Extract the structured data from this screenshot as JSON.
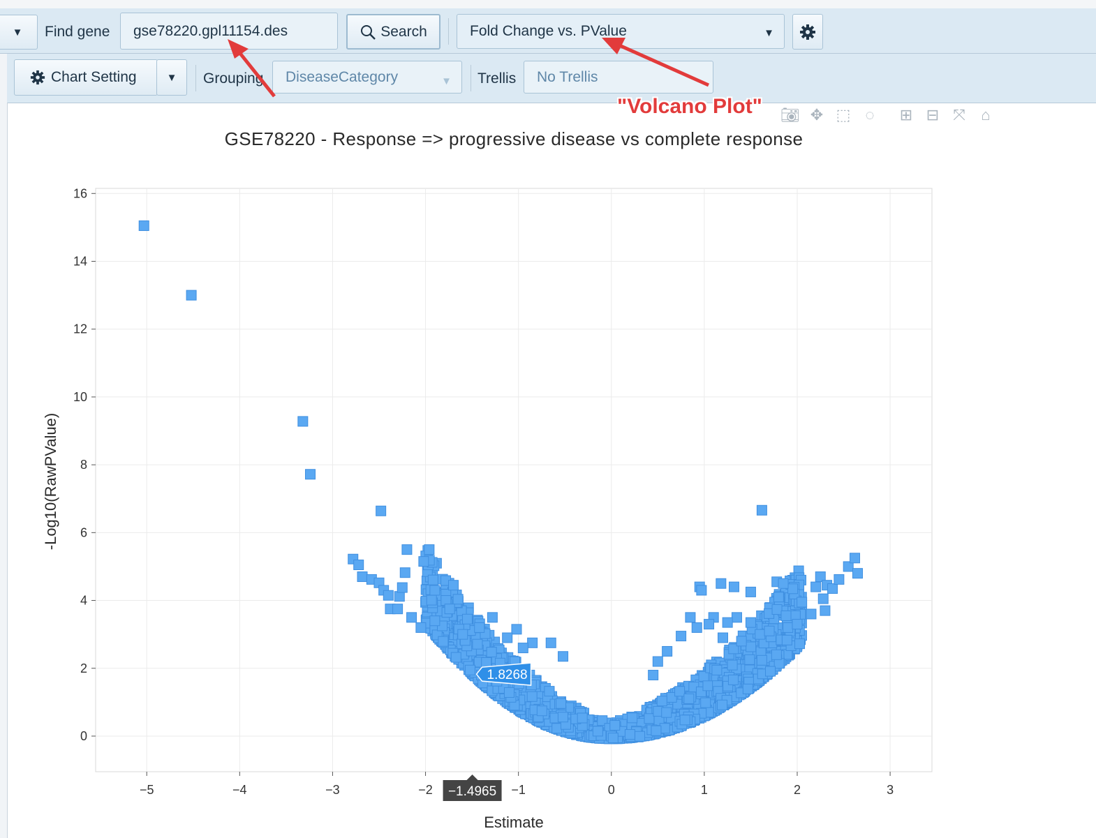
{
  "toolbar": {
    "find_gene_label": "Find gene",
    "gene_input_value": "gse78220.gpl11154.des",
    "search_label": "Search",
    "plot_type_value": "Fold Change vs. PValue"
  },
  "chart_toolbar": {
    "chart_setting_label": "Chart Setting",
    "grouping_label": "Grouping",
    "grouping_value": "DiseaseCategory",
    "trellis_label": "Trellis",
    "trellis_value": "No Trellis"
  },
  "annotation_text": "\"Volcano Plot\"",
  "colors": {
    "marker": "#5aa8f2",
    "marker_stroke": "#3f8fe0",
    "arrow": "#e23b3b",
    "toolbar_bg": "#dbe9f3"
  },
  "chart_data": {
    "type": "scatter",
    "title": "GSE78220 - Response => progressive disease vs complete response",
    "xlabel": "Estimate",
    "ylabel": "-Log10(RawPValue)",
    "xlim": [
      -5.55,
      3.45
    ],
    "ylim": [
      -1.05,
      16.15
    ],
    "xticks": [
      -5,
      -4,
      -3,
      -2,
      -1,
      0,
      1,
      2,
      3
    ],
    "yticks": [
      0,
      2,
      4,
      6,
      8,
      10,
      12,
      14,
      16
    ],
    "grid": true,
    "hover_y_label": "1.8268",
    "hover_x_label": "−1.4965",
    "points": [
      [
        -5.03,
        15.05
      ],
      [
        -4.52,
        13.0
      ],
      [
        -3.32,
        9.28
      ],
      [
        -3.24,
        7.72
      ],
      [
        -2.48,
        6.64
      ],
      [
        1.62,
        6.66
      ],
      [
        -2.78,
        5.22
      ],
      [
        -2.72,
        5.05
      ],
      [
        -2.68,
        4.7
      ],
      [
        -2.58,
        4.62
      ],
      [
        -2.5,
        4.52
      ],
      [
        -2.45,
        4.3
      ],
      [
        -2.4,
        4.15
      ],
      [
        -2.38,
        3.75
      ],
      [
        -2.3,
        3.75
      ],
      [
        -2.28,
        4.12
      ],
      [
        -2.25,
        4.38
      ],
      [
        -2.22,
        4.82
      ],
      [
        -2.2,
        5.5
      ],
      [
        -2.02,
        5.15
      ],
      [
        -1.96,
        5.5
      ],
      [
        -1.9,
        4.3
      ],
      [
        -1.7,
        4.45
      ],
      [
        -1.78,
        4.0
      ],
      [
        -1.74,
        3.75
      ],
      [
        -1.82,
        3.25
      ],
      [
        -1.55,
        3.45
      ],
      [
        -1.28,
        3.5
      ],
      [
        -1.02,
        3.15
      ],
      [
        -0.85,
        2.75
      ],
      [
        -0.65,
        2.75
      ],
      [
        -0.52,
        2.35
      ],
      [
        -1.42,
        3.2
      ],
      [
        -1.12,
        2.9
      ],
      [
        -0.95,
        2.6
      ],
      [
        -1.6,
        3.0
      ],
      [
        -2.05,
        3.2
      ],
      [
        -1.9,
        3.4
      ],
      [
        -2.15,
        3.5
      ],
      [
        0.95,
        4.4
      ],
      [
        0.97,
        4.3
      ],
      [
        1.18,
        4.5
      ],
      [
        1.32,
        4.4
      ],
      [
        1.5,
        4.25
      ],
      [
        1.78,
        4.55
      ],
      [
        1.85,
        4.5
      ],
      [
        1.8,
        4.1
      ],
      [
        1.88,
        3.55
      ],
      [
        1.9,
        3.2
      ],
      [
        2.05,
        3.95
      ],
      [
        2.2,
        4.4
      ],
      [
        2.25,
        4.7
      ],
      [
        2.32,
        4.45
      ],
      [
        2.38,
        4.35
      ],
      [
        2.45,
        4.62
      ],
      [
        2.55,
        5.0
      ],
      [
        2.62,
        5.25
      ],
      [
        2.65,
        4.8
      ],
      [
        2.28,
        4.05
      ],
      [
        2.3,
        3.7
      ],
      [
        2.15,
        3.6
      ],
      [
        2.0,
        3.3
      ],
      [
        1.35,
        3.5
      ],
      [
        1.5,
        3.35
      ],
      [
        1.25,
        3.35
      ],
      [
        1.1,
        3.5
      ],
      [
        1.05,
        3.3
      ],
      [
        0.85,
        3.5
      ],
      [
        0.92,
        3.2
      ],
      [
        0.75,
        2.95
      ],
      [
        0.6,
        2.5
      ],
      [
        0.5,
        2.2
      ],
      [
        0.45,
        1.8
      ],
      [
        1.2,
        2.9
      ],
      [
        1.4,
        2.8
      ],
      [
        1.6,
        3.0
      ],
      [
        1.7,
        3.1
      ]
    ],
    "curve_sample_count": 2200,
    "curve_left_coefficient": 0.86,
    "curve_right_coefficient": 0.68
  }
}
